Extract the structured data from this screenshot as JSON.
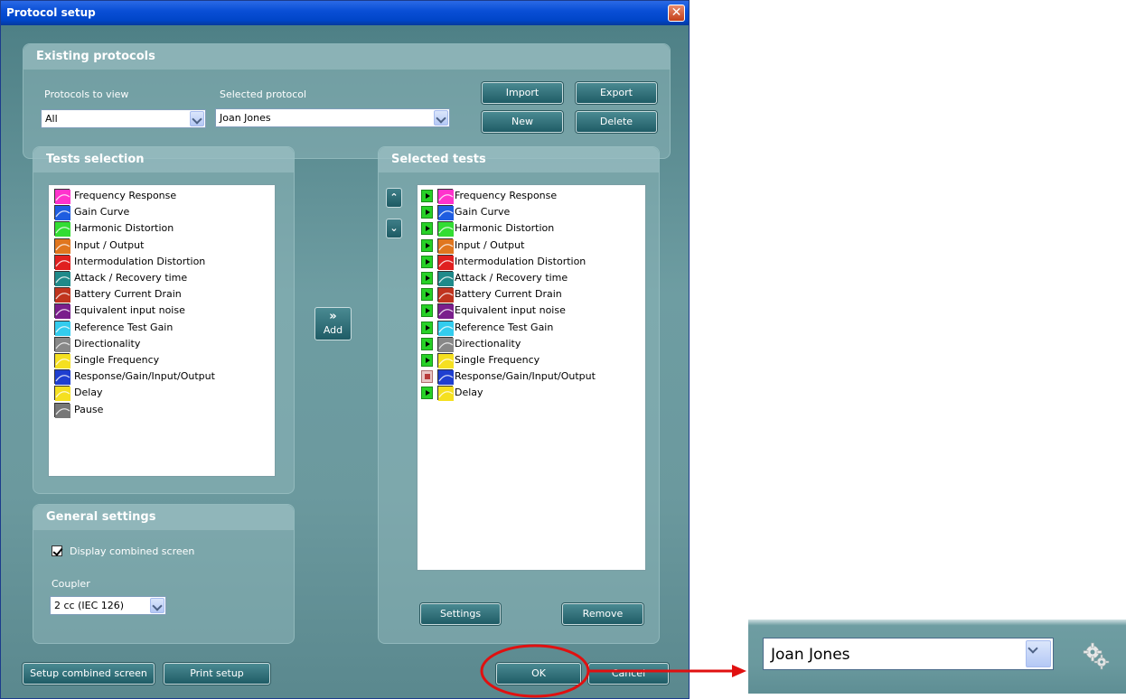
{
  "window": {
    "title": "Protocol setup",
    "close": "✕"
  },
  "existing": {
    "header": "Existing protocols",
    "protocols_label": "Protocols to view",
    "protocols_value": "All",
    "selected_label": "Selected protocol",
    "selected_value": "Joan Jones",
    "import_label": "Import",
    "export_label": "Export",
    "new_label": "New",
    "delete_label": "Delete"
  },
  "tests_selection": {
    "header": "Tests selection",
    "items": [
      {
        "label": "Frequency Response",
        "icon": "frequency-response-icon",
        "color": "#ff33cc"
      },
      {
        "label": "Gain Curve",
        "icon": "gain-curve-icon",
        "color": "#1f5de0"
      },
      {
        "label": "Harmonic Distortion",
        "icon": "harmonic-distortion-icon",
        "color": "#33dd33"
      },
      {
        "label": "Input / Output",
        "icon": "input-output-icon",
        "color": "#e0761f"
      },
      {
        "label": "Intermodulation Distortion",
        "icon": "intermodulation-distortion-icon",
        "color": "#e02020"
      },
      {
        "label": "Attack / Recovery time",
        "icon": "attack-recovery-icon",
        "color": "#1f8a8a"
      },
      {
        "label": "Battery Current Drain",
        "icon": "battery-current-drain-icon",
        "color": "#c0341e"
      },
      {
        "label": "Equivalent input noise",
        "icon": "equivalent-input-noise-icon",
        "color": "#7a1e8c"
      },
      {
        "label": "Reference Test Gain",
        "icon": "reference-test-gain-icon",
        "color": "#33ccee"
      },
      {
        "label": "Directionality",
        "icon": "directionality-icon",
        "color": "#888888"
      },
      {
        "label": "Single Frequency",
        "icon": "single-frequency-icon",
        "color": "#f5e020"
      },
      {
        "label": "Response/Gain/Input/Output",
        "icon": "response-gain-input-output-icon",
        "color": "#1f3fd0"
      },
      {
        "label": "Delay",
        "icon": "delay-icon",
        "color": "#f5e020"
      },
      {
        "label": "Pause",
        "icon": "pause-icon",
        "color": "#777777"
      }
    ]
  },
  "add_label": "Add",
  "move_up": "⌃",
  "move_down": "⌄",
  "selected_tests": {
    "header": "Selected tests",
    "items": [
      {
        "label": "Frequency Response",
        "state": "play",
        "color": "#ff33cc"
      },
      {
        "label": "Gain Curve",
        "state": "play",
        "color": "#1f5de0"
      },
      {
        "label": "Harmonic Distortion",
        "state": "play",
        "color": "#33dd33"
      },
      {
        "label": "Input / Output",
        "state": "play",
        "color": "#e0761f"
      },
      {
        "label": "Intermodulation Distortion",
        "state": "play",
        "color": "#e02020"
      },
      {
        "label": "Attack / Recovery time",
        "state": "play",
        "color": "#1f8a8a"
      },
      {
        "label": "Battery Current Drain",
        "state": "play",
        "color": "#c0341e"
      },
      {
        "label": "Equivalent input noise",
        "state": "play",
        "color": "#7a1e8c"
      },
      {
        "label": "Reference Test Gain",
        "state": "play",
        "color": "#33ccee"
      },
      {
        "label": "Directionality",
        "state": "play",
        "color": "#888888"
      },
      {
        "label": "Single Frequency",
        "state": "play",
        "color": "#f5e020"
      },
      {
        "label": "Response/Gain/Input/Output",
        "state": "stop",
        "color": "#1f3fd0"
      },
      {
        "label": "Delay",
        "state": "play",
        "color": "#f5e020"
      }
    ],
    "settings_label": "Settings",
    "remove_label": "Remove"
  },
  "general": {
    "header": "General settings",
    "display_combined_label": "Display combined screen",
    "display_combined_checked": true,
    "coupler_label": "Coupler",
    "coupler_value": "2 cc (IEC 126)"
  },
  "footer": {
    "setup_combined_label": "Setup combined screen",
    "print_setup_label": "Print setup",
    "ok_label": "OK",
    "cancel_label": "Cancel"
  },
  "zoom": {
    "selected_value": "Joan Jones"
  },
  "colors": {
    "highlight": "#e01010",
    "window_bg": "#6f9aa0"
  }
}
